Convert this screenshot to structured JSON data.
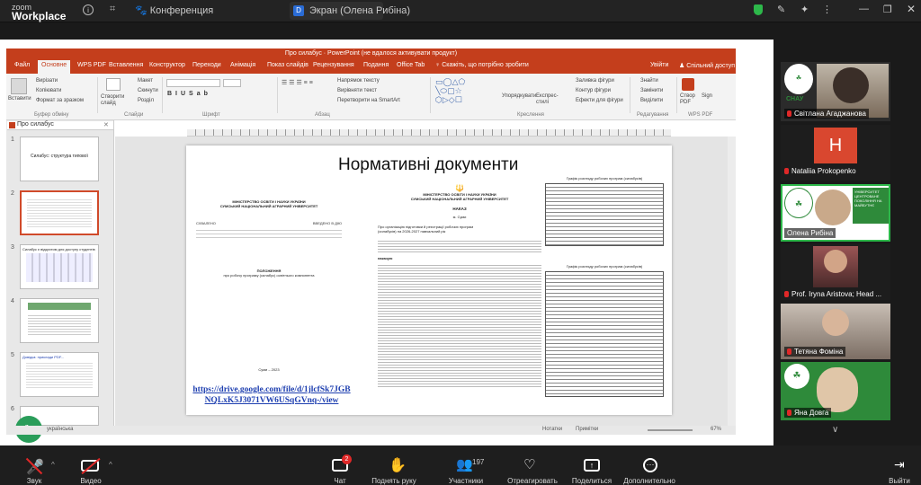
{
  "app": {
    "logo_line1": "zoom",
    "logo_line2": "Workplace",
    "tab_conference": "Конференция",
    "tab_screen": "Экран (Олена Рибіна)",
    "tab_d": "D"
  },
  "ppt": {
    "title": "Про силабус · PowerPoint (не вдалося активувати продукт)",
    "tabs": [
      "Файл",
      "Основне",
      "WPS PDF",
      "Вставлення",
      "Конструктор",
      "Переходи",
      "Анімація",
      "Показ слайдів",
      "Рецензування",
      "Подання",
      "Office Tab"
    ],
    "tell": "Скажіть, що потрібно зробити",
    "login": "Увійти",
    "share": "Спільний доступ",
    "ribbon": {
      "paste": "Вставити",
      "cut": "Вирізати",
      "copy": "Копіювати",
      "format": "Формат за зразком",
      "clipboard": "Буфер обміну",
      "new_slide": "Створити слайд",
      "layout": "Макет",
      "reset": "Скинути",
      "section": "Розділ",
      "slides": "Слайди",
      "font": "Шрифт",
      "paragraph": "Абзац",
      "text_dir": "Напрямок тексту",
      "align_text": "Вирівняти текст",
      "smartart": "Перетворити на SmartArt",
      "arrange": "Упорядкувати",
      "styles": "Експрес-стилі",
      "fill": "Заливка фігури",
      "outline": "Контур фігури",
      "effects": "Ефекти для фігури",
      "drawing": "Креслення",
      "find": "Знайти",
      "replace": "Замінити",
      "select": "Виділити",
      "editing": "Редагування",
      "create_pdf": "Створ PDF",
      "sign": "Sign",
      "wps_pdf": "WPS PDF"
    },
    "pane_title": "Про силабус",
    "slide_nums": [
      "1",
      "2",
      "3",
      "4",
      "5",
      "6"
    ],
    "thumb1": "Силабус: структура типової",
    "thumb3": "Силабус є відкритим для доступу студентів",
    "thumb5": "Довідка: приклади PDF...",
    "slide": {
      "heading": "Нормативні документи",
      "doc1_h1": "МІНІСТЕРСТВО ОСВІТИ І НАУКИ УКРАЇНИ",
      "doc1_h2": "СУМСЬКИЙ НАЦІОНАЛЬНИЙ АГРАРНИЙ УНІВЕРСИТЕТ",
      "doc1_left": "СХВАЛЕНО",
      "doc1_right": "ВВЕДЕНО В ДІЮ",
      "doc1_pol": "ПОЛОЖЕННЯ",
      "doc1_about": "про робочу програму (силабус) освітнього компонента",
      "doc1_city": "Суми – 2023",
      "link1": "https://drive.google.com/file/d/1jlcfSk7JGB",
      "link2": "NQLxK5J3071VW6USqGVnq-/view",
      "doc2_h1": "МІНІСТЕРСТВО ОСВІТИ І НАУКИ УКРАЇНИ",
      "doc2_h2": "СУМСЬКИЙ НАЦІОНАЛЬНИЙ АГРАРНИЙ УНІВЕРСИТЕТ",
      "doc2_order": "НАКАЗ",
      "doc2_city": "м. Суми",
      "doc2_subj": "Про організацію підготовки й реєстрації робочих програм (силабусів) на 2026-2027 навчальний рік",
      "doc2_body": "наказую",
      "doc3_head": "Графік розгляду робочих програм (силабусів)",
      "doc3_head2": "Графік розгляду робочих програм (силабусів)"
    },
    "status": "українська",
    "status_notes": "Нотатки",
    "status_comments": "Примітки",
    "zoom": "67%"
  },
  "gallery": [
    {
      "name": "Світлана Агаджанова",
      "type": "video"
    },
    {
      "name": "Nataliia Prokopenko",
      "initial": "H",
      "type": "avatar"
    },
    {
      "name": "Олена Рибіна",
      "type": "video",
      "logo": "УНІВЕРСИТЕТ ЦЕНТРОВАНЕ ПОКОЛІННЯ НА МАЙБУТНЄ"
    },
    {
      "name": "Prof. Iryna Aristova; Head ...",
      "type": "video"
    },
    {
      "name": "Тетяна Фоміна",
      "type": "video"
    },
    {
      "name": "Яна Довга",
      "type": "video"
    }
  ],
  "gallery_more": "∨",
  "snau": "СНАУ",
  "bottom": {
    "audio": "Звук",
    "video": "Видео",
    "participants": "Участники",
    "participants_count": "197",
    "chat": "Чат",
    "chat_badge": "2",
    "raise": "Поднять руку",
    "react": "Отреагировать",
    "share": "Поделиться",
    "more": "Дополнительно",
    "leave": "Выйти"
  },
  "colors": {
    "zoom_bg": "#1a1a1a",
    "ppt_accent": "#c43e1c",
    "mute_red": "#e02828",
    "link": "#1e3fb0"
  }
}
